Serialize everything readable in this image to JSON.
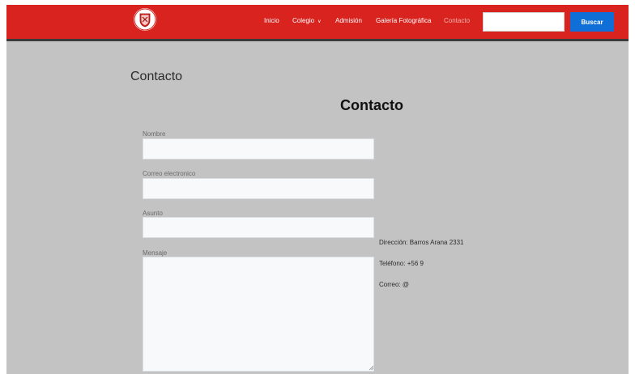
{
  "navbar": {
    "logo_icon": "school-crest-icon",
    "items": [
      {
        "label": "Inicio"
      },
      {
        "label": "Colegio",
        "icon": "chevron-down-icon"
      },
      {
        "label": "Admisión"
      },
      {
        "label": "Galería Fotográfica"
      },
      {
        "label": "Contacto",
        "active": true
      }
    ],
    "search": {
      "value": "",
      "placeholder": "",
      "button_label": "Buscar"
    },
    "colors": {
      "bar": "#d8231f",
      "button": "#0f6fd6"
    }
  },
  "main": {
    "page_heading": "Contacto",
    "form_title": "Contacto",
    "fields": {
      "name": {
        "label": "Nombre",
        "value": ""
      },
      "email": {
        "label": "Correo electronico",
        "value": ""
      },
      "subject": {
        "label": "Asunto",
        "value": ""
      },
      "message": {
        "label": "Mensaje",
        "value": ""
      }
    },
    "contact_info": {
      "address": "Dirección: Barros Arana 2331",
      "phone": "Teléfono: +56 9",
      "email": "Correo: @"
    }
  }
}
